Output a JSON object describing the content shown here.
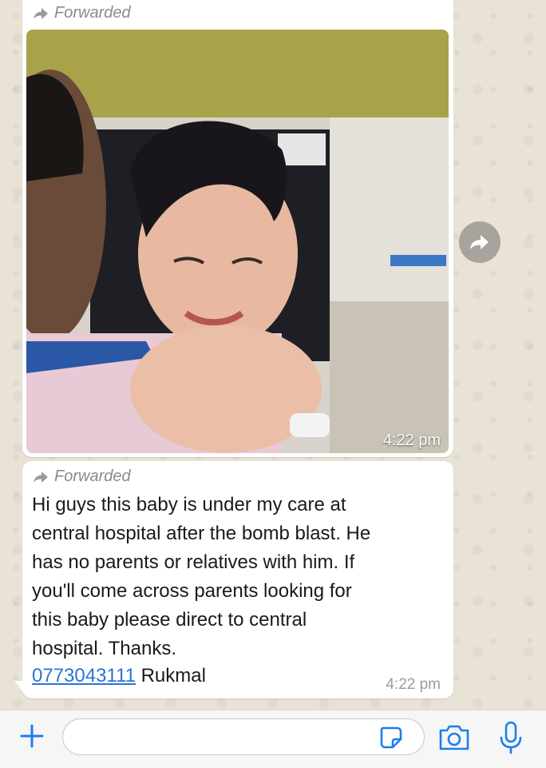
{
  "chat": {
    "messages": [
      {
        "forwarded_label": "Forwarded",
        "type": "image",
        "time": "4:22 pm"
      },
      {
        "forwarded_label": "Forwarded",
        "type": "text",
        "text": "Hi guys this baby is under my care at\ncentral hospital after the bomb blast. He\nhas no parents or relatives with him. If\nyou'll come across parents looking for\nthis baby please direct to central\nhospital. Thanks.",
        "phone": "0773043111",
        "name": " Rukmal",
        "time": "4:22 pm"
      }
    ]
  },
  "composer": {
    "placeholder": ""
  },
  "colors": {
    "accent": "#1a7ef2",
    "link": "#2c74d6",
    "bubble": "#ffffff",
    "chat_background": "#e8e2d7"
  },
  "icons": [
    "forward-icon",
    "share-forward-icon",
    "plus-icon",
    "sticker-icon",
    "camera-icon",
    "microphone-icon"
  ]
}
